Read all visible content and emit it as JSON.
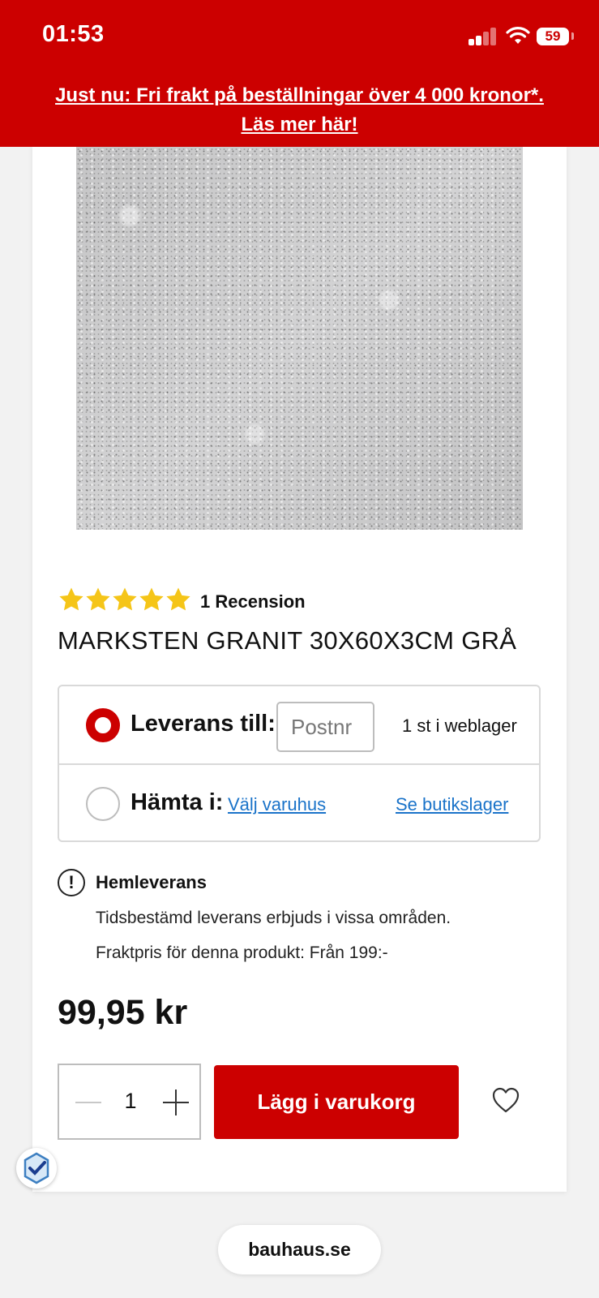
{
  "status_bar": {
    "time": "01:53",
    "battery": "59"
  },
  "promo": {
    "line1": "Just nu: Fri frakt på beställningar över 4 000 kronor*.",
    "line2": "Läs mer här!"
  },
  "product": {
    "rating": 5,
    "rating_max": 5,
    "review_count_label": "1 Recension",
    "title": "MARKSTEN GRANIT 30X60X3CM GRÅ",
    "price": "99,95 kr"
  },
  "delivery": {
    "option1_label": "Leverans till:",
    "postnr_placeholder": "Postnr",
    "stock_text": "1 st i weblager",
    "option2_label": "Hämta i:",
    "choose_store_link": "Välj varuhus",
    "store_stock_link": "Se butikslager",
    "selected": "delivery"
  },
  "info": {
    "title": "Hemleverans",
    "line1": "Tidsbestämd leverans erbjuds i vissa områden.",
    "line2": "Fraktpris för denna produkt: Från 199:-"
  },
  "cart": {
    "quantity": "1",
    "add_label": "Lägg i varukorg"
  },
  "browser": {
    "url": "bauhaus.se"
  },
  "colors": {
    "brand_red": "#cc0000",
    "star_yellow": "#f5c518",
    "link_blue": "#1a73c9"
  },
  "icons": [
    "info-icon",
    "minus-icon",
    "plus-icon",
    "heart-icon",
    "trust-badge-icon",
    "wifi-icon",
    "signal-icon",
    "star-icon"
  ]
}
